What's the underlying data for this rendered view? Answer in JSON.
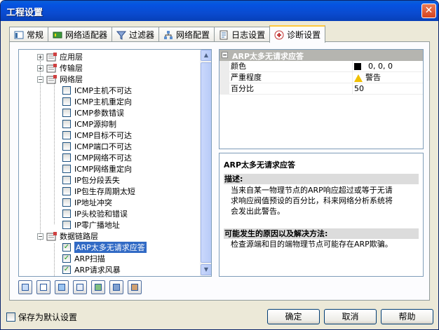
{
  "window": {
    "title": "工程设置",
    "close_icon": "close-icon"
  },
  "tabs": [
    {
      "label": "常规",
      "icon": "general-icon"
    },
    {
      "label": "网络适配器",
      "icon": "network-adapter-icon"
    },
    {
      "label": "过滤器",
      "icon": "filter-icon"
    },
    {
      "label": "网络配置",
      "icon": "network-config-icon"
    },
    {
      "label": "日志设置",
      "icon": "log-icon"
    },
    {
      "label": "诊断设置",
      "icon": "diagnosis-icon",
      "active": true
    }
  ],
  "tree": {
    "groups": [
      {
        "label": "应用层",
        "expanded": false
      },
      {
        "label": "传输层",
        "expanded": false
      },
      {
        "label": "网络层",
        "expanded": true,
        "items": [
          {
            "label": "ICMP主机不可达",
            "checked": false
          },
          {
            "label": "ICMP主机重定向",
            "checked": false
          },
          {
            "label": "ICMP参数错误",
            "checked": false
          },
          {
            "label": "ICMP源抑制",
            "checked": false
          },
          {
            "label": "ICMP目标不可达",
            "checked": false
          },
          {
            "label": "ICMP端口不可达",
            "checked": false
          },
          {
            "label": "ICMP网络不可达",
            "checked": false
          },
          {
            "label": "ICMP网络重定向",
            "checked": false
          },
          {
            "label": "IP包分段丢失",
            "checked": false
          },
          {
            "label": "IP包生存周期太短",
            "checked": false
          },
          {
            "label": "IP地址冲突",
            "checked": false
          },
          {
            "label": "IP头校验和错误",
            "checked": false
          },
          {
            "label": "IP零广播地址",
            "checked": false
          }
        ]
      },
      {
        "label": "数据链路层",
        "expanded": true,
        "items": [
          {
            "label": "ARP太多无请求应答",
            "checked": true,
            "selected": true
          },
          {
            "label": "ARP扫描",
            "checked": true
          },
          {
            "label": "ARP请求风暴",
            "checked": true
          }
        ]
      }
    ]
  },
  "toolbar_icons": [
    "check-all-icon",
    "uncheck-all-icon",
    "invert-check-icon",
    "properties-icon",
    "import-icon",
    "export-icon",
    "reset-icon"
  ],
  "properties": {
    "header": "ARP太多无请求应答",
    "rows": [
      {
        "key": "颜色",
        "value": "0, 0, 0",
        "swatch": "#000000"
      },
      {
        "key": "严重程度",
        "value": "警告",
        "icon": "warning-icon"
      },
      {
        "key": "百分比",
        "value": "50"
      }
    ]
  },
  "description": {
    "title": "ARP太多无请求应答",
    "desc_heading": "描述:",
    "desc_lines": [
      "当来自某一物理节点的ARP响应超过或等于无请",
      "求响应阀值预设的百分比，科来网络分析系统将",
      "会发出此警告。"
    ],
    "cause_heading": "可能发生的原因以及解决方法:",
    "cause_lines": [
      "检查源端和目的端物理节点可能存在ARP欺骗。"
    ]
  },
  "footer": {
    "save_default": "保存为默认设置",
    "ok": "确定",
    "cancel": "取消",
    "help": "帮助"
  },
  "colors": {
    "selection": "#316ac5",
    "titlebar": "#0553e1",
    "check": "#21a121"
  }
}
